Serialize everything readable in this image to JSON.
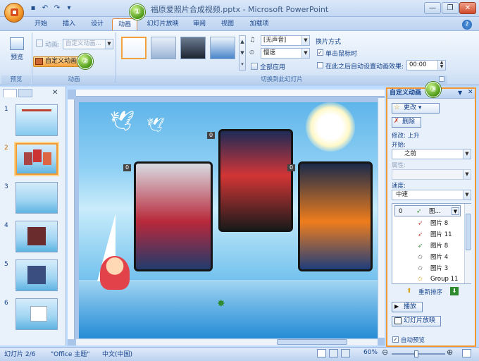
{
  "window": {
    "title": "福原爱照片合成视频.pptx - Microsoft PowerPoint"
  },
  "tabs": [
    "开始",
    "插入",
    "设计",
    "动画",
    "幻灯片放映",
    "审阅",
    "视图",
    "加载项"
  ],
  "active_tab": "动画",
  "ribbon": {
    "preview_label": "预览",
    "preview_group": "预览",
    "animation_dropdown": "动画:",
    "animation_dropdown_value": "自定义动画...",
    "custom_animation_button": "自定义动画",
    "animation_group": "动画",
    "sound_value": "[无声音]",
    "speed_value": "慢速",
    "apply_all": "全部应用",
    "advance_heading": "换片方式",
    "on_click": "单击鼠标时",
    "after_time": "在此之后自动设置动画效果:",
    "after_time_value": "00:00",
    "transition_group": "切换到此幻灯片"
  },
  "callouts": [
    "①",
    "②",
    "③"
  ],
  "slides_pane": {
    "numbers": [
      "1",
      "2",
      "3",
      "4",
      "5",
      "6"
    ],
    "selected": "2"
  },
  "slide": {
    "tags": [
      "0",
      "0",
      "0"
    ]
  },
  "task_pane": {
    "title": "自定义动画",
    "change_button": "更改",
    "remove_button": "删除",
    "modify_label": "修改: 上升",
    "start_label": "开始:",
    "start_value": "之前",
    "property_label": "属性:",
    "property_value": "",
    "speed_label": "速度:",
    "speed_value": "中速",
    "animations": [
      {
        "num": "0",
        "name": "图...",
        "icon_color": "#2f8a2f"
      },
      {
        "num": "",
        "name": "图片 8",
        "icon_color": "#c0392b"
      },
      {
        "num": "",
        "name": "图片 11",
        "icon_color": "#c0392b"
      },
      {
        "num": "",
        "name": "图片 8",
        "icon_color": "#2f8a2f"
      },
      {
        "num": "",
        "name": "图片 4",
        "icon_color": "#444444"
      },
      {
        "num": "",
        "name": "图片 3",
        "icon_color": "#444444"
      },
      {
        "num": "",
        "name": "Group 11",
        "icon_color": "#d4a017"
      }
    ],
    "reorder_label": "重新排序",
    "play_button": "播放",
    "slideshow_button": "幻灯片放映",
    "autopreview_label": "自动预览"
  },
  "status": {
    "slide_info": "幻灯片 2/6",
    "theme": "\"Office 主题\"",
    "language": "中文(中国)",
    "zoom": "60%"
  }
}
